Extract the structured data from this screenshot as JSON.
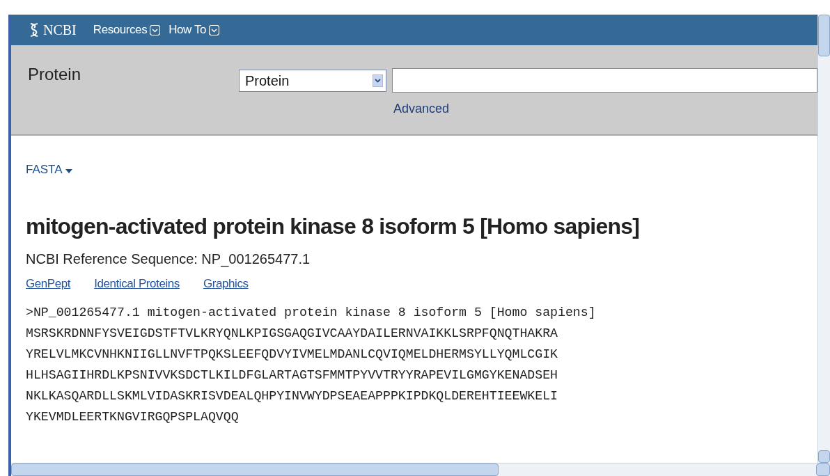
{
  "header": {
    "logo": "NCBI",
    "menus": [
      {
        "label": "Resources"
      },
      {
        "label": "How To"
      }
    ]
  },
  "search": {
    "database_label": "Protein",
    "database_select": "Protein",
    "advanced_link": "Advanced"
  },
  "format_menu": {
    "label": "FASTA"
  },
  "record": {
    "title": "mitogen-activated protein kinase 8 isoform 5 [Homo sapiens]",
    "reference": "NCBI Reference Sequence: NP_001265477.1",
    "links": [
      "GenPept",
      "Identical Proteins",
      "Graphics"
    ],
    "fasta": [
      ">NP_001265477.1 mitogen-activated protein kinase 8 isoform 5 [Homo sapiens]",
      "MSRSKRDNNFYSVEIGDSTFTVLKRYQNLKPIGSGAQGIVCAAYDAILERNVAIKKLSRPFQNQTHAKRA",
      "YRELVLMKCVNHKNIIGLLNVFTPQKSLEEFQDVYIVMELMDANLCQVIQMELDHERMSYLLYQMLCGIK",
      "HLHSAGIIHRDLKPSNIVVKSDCTLKILDFGLARTAGTSFMMTPYVVTRYYRAPEVILGMGYKENADSEH",
      "NKLKASQARDLLSKMLVIDASKRISVDEALQHPYINVWYDPSEAEAPPPKIPDKQLDEREHTIEEWKELI",
      "YKEVMDLEERTKNGVIRGQPSPLAQVQQ"
    ]
  }
}
